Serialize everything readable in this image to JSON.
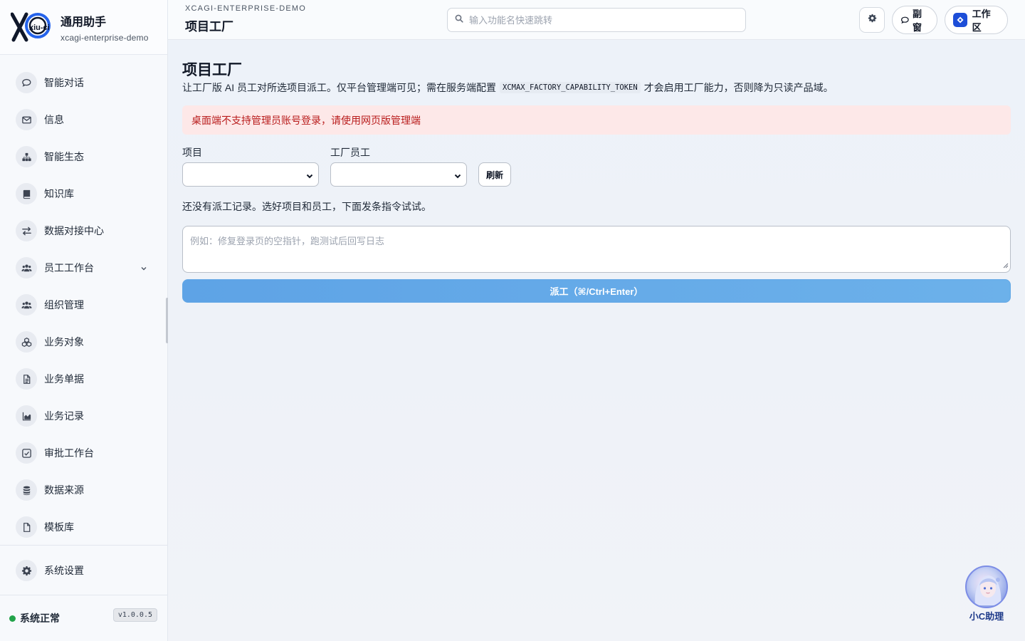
{
  "brand": {
    "logo_text": "xiu-ci",
    "title": "通用助手",
    "subtitle": "xcagi-enterprise-demo"
  },
  "sidebar": {
    "items": [
      {
        "label": "智能对话",
        "icon": "chat-icon"
      },
      {
        "label": "信息",
        "icon": "mail-icon"
      },
      {
        "label": "智能生态",
        "icon": "ecosystem-icon"
      },
      {
        "label": "知识库",
        "icon": "book-icon"
      },
      {
        "label": "数据对接中心",
        "icon": "exchange-icon"
      },
      {
        "label": "员工工作台",
        "icon": "users-icon",
        "expandable": true
      },
      {
        "label": "组织管理",
        "icon": "users-icon"
      },
      {
        "label": "业务对象",
        "icon": "cubes-icon"
      },
      {
        "label": "业务单据",
        "icon": "document-icon"
      },
      {
        "label": "业务记录",
        "icon": "chart-icon"
      },
      {
        "label": "审批工作台",
        "icon": "check-square-icon"
      },
      {
        "label": "数据来源",
        "icon": "database-icon"
      },
      {
        "label": "模板库",
        "icon": "file-icon"
      }
    ],
    "settings": {
      "label": "系统设置",
      "icon": "gear-icon"
    },
    "status": {
      "text": "系统正常",
      "color": "#22a34a"
    },
    "version": "v1.0.0.5"
  },
  "header": {
    "kicker": "XCAGI-ENTERPRISE-DEMO",
    "title": "项目工厂",
    "search_placeholder": "输入功能名快速跳转",
    "subwindow_label": "副窗",
    "workspace_label": "工作区"
  },
  "main": {
    "title": "项目工厂",
    "desc_before": "让工厂版 AI 员工对所选项目派工。仅平台管理端可见；需在服务端配置",
    "desc_code": "XCMAX_FACTORY_CAPABILITY_TOKEN",
    "desc_after": "才会启用工厂能力，否则降为只读产品域。",
    "alert": "桌面端不支持管理员账号登录，请使用网页版管理端",
    "project_label": "项目",
    "employee_label": "工厂员工",
    "project_value": "",
    "employee_value": "",
    "refresh_label": "刷新",
    "empty_text": "还没有派工记录。选好项目和员工，下面发条指令试试。",
    "instruction_placeholder": "例如：修复登录页的空指针，跑测试后回写日志",
    "dispatch_label": "派工（⌘/Ctrl+Enter）"
  },
  "assistant": {
    "label": "小C助理"
  },
  "colors": {
    "accent": "#1d4ed8",
    "dispatch_button": "#6cb1ea",
    "alert_bg": "#fde8e8",
    "alert_text": "#b91c1c"
  }
}
